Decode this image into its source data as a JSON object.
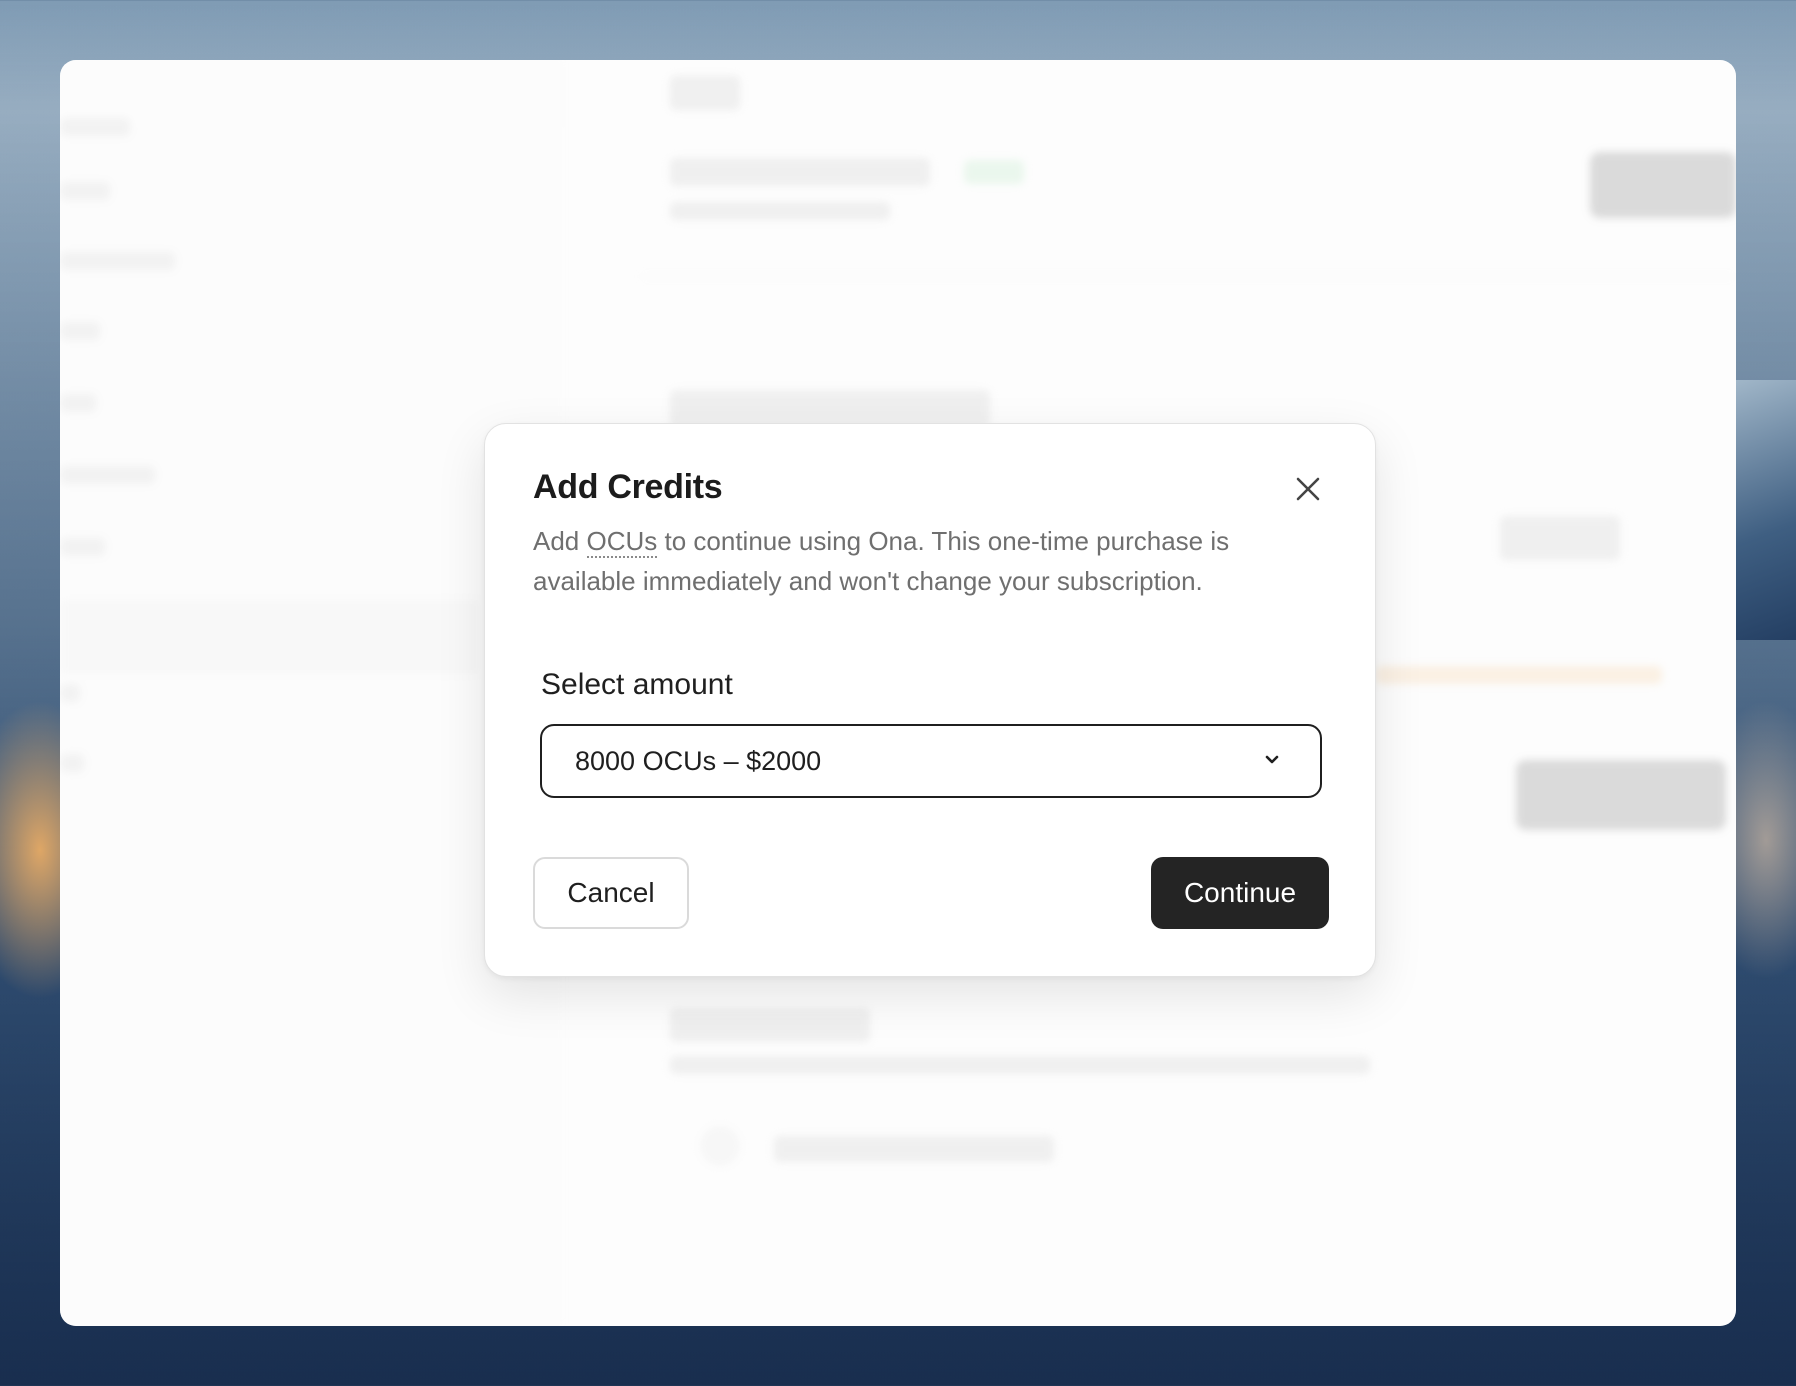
{
  "dialog": {
    "title": "Add Credits",
    "description_prefix": "Add ",
    "description_term": "OCUs",
    "description_suffix": " to continue using Ona. This one-time purchase is available immediately and won't change your subscription.",
    "select_label": "Select amount",
    "selected_amount": "8000 OCUs – $2000",
    "cancel_label": "Cancel",
    "continue_label": "Continue",
    "close_icon": "close-icon",
    "chevron_icon": "chevron-down-icon"
  },
  "colors": {
    "primary_button": "#242424",
    "primary_text": "#ffffff",
    "muted_text": "#6f6f6f"
  }
}
